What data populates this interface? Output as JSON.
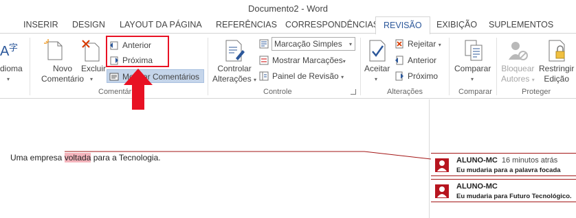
{
  "window": {
    "title": "Documento2 - Word"
  },
  "tabs": [
    {
      "label": "INSERIR"
    },
    {
      "label": "DESIGN"
    },
    {
      "label": "LAYOUT DA PÁGINA"
    },
    {
      "label": "REFERÊNCIAS"
    },
    {
      "label": "CORRESPONDÊNCIAS"
    },
    {
      "label": "REVISÃO",
      "active": true
    },
    {
      "label": "EXIBIÇÃO"
    },
    {
      "label": "SUPLEMENTOS"
    }
  ],
  "ribbon": {
    "language": {
      "label": "dioma"
    },
    "comments": {
      "novo": [
        "Novo",
        "Comentário"
      ],
      "excluir": "Excluir",
      "anterior": "Anterior",
      "proxima": "Próxima",
      "mostrar": "Mostrar Comentários",
      "group_label": "Comentários"
    },
    "tracking": {
      "controlar": [
        "Controlar",
        "Alterações"
      ],
      "markup_select": "Marcação Simples",
      "mostrar_marcacoes": "Mostrar Marcações",
      "painel": "Painel de Revisão",
      "group_label": "Controle"
    },
    "changes": {
      "aceitar": "Aceitar",
      "rejeitar": "Rejeitar",
      "anterior": "Anterior",
      "proximo": "Próximo",
      "group_label": "Alterações"
    },
    "compare": {
      "comparar": "Comparar",
      "group_label": "Comparar"
    },
    "protect": {
      "bloquear": [
        "Bloquear",
        "Autores"
      ],
      "restringir": [
        "Restringir",
        "Edição"
      ],
      "group_label": "Proteger"
    }
  },
  "document": {
    "text_before": "Uma empresa ",
    "text_highlight": "voltada",
    "text_after": " para a Tecnologia."
  },
  "comments": [
    {
      "author": "ALUNO-MC",
      "time": "16 minutos atrás",
      "body": "Eu mudaria para a palavra focada"
    },
    {
      "author": "ALUNO-MC",
      "time": "",
      "body": "Eu mudaria para Futuro Tecnológico."
    }
  ],
  "colors": {
    "accent": "#2b579a",
    "highlight_box": "#e81123",
    "comment_color": "#a31515"
  }
}
